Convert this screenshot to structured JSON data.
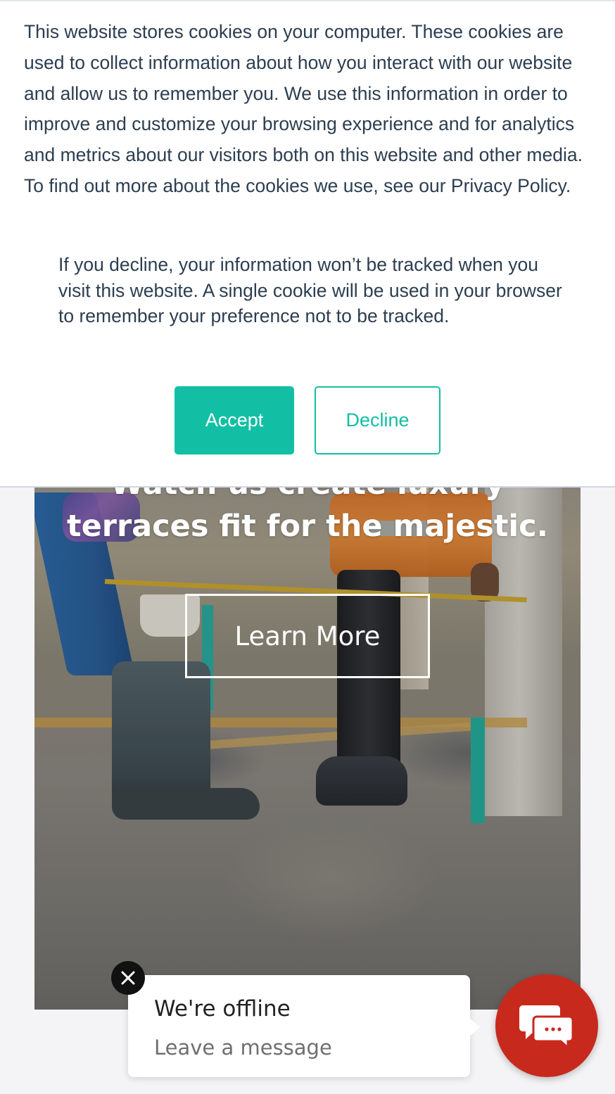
{
  "cookie_banner": {
    "message": "This website stores cookies on your computer. These cookies are used to collect information about how you interact with our website and allow us to remember you. We use this information in order to improve and customize your browsing experience and for analytics and metrics about our visitors both on this website and other media. To find out more about the cookies we use, see our Privacy Policy.",
    "decline_note": "If you decline, your information won’t be tracked when you visit this website. A single cookie will be used in your browser to remember your preference not to be tracked.",
    "accept_label": "Accept",
    "decline_label": "Decline",
    "accent_color": "#12bfa4"
  },
  "hero": {
    "title": "Watch us create luxury terraces fit for the majestic.",
    "cta_label": "Learn More"
  },
  "chat": {
    "title": "We're offline",
    "subtitle": "Leave a message",
    "launcher_color": "#c8291d",
    "close_icon": "close-icon",
    "launcher_icon": "chat-bubbles-icon"
  }
}
